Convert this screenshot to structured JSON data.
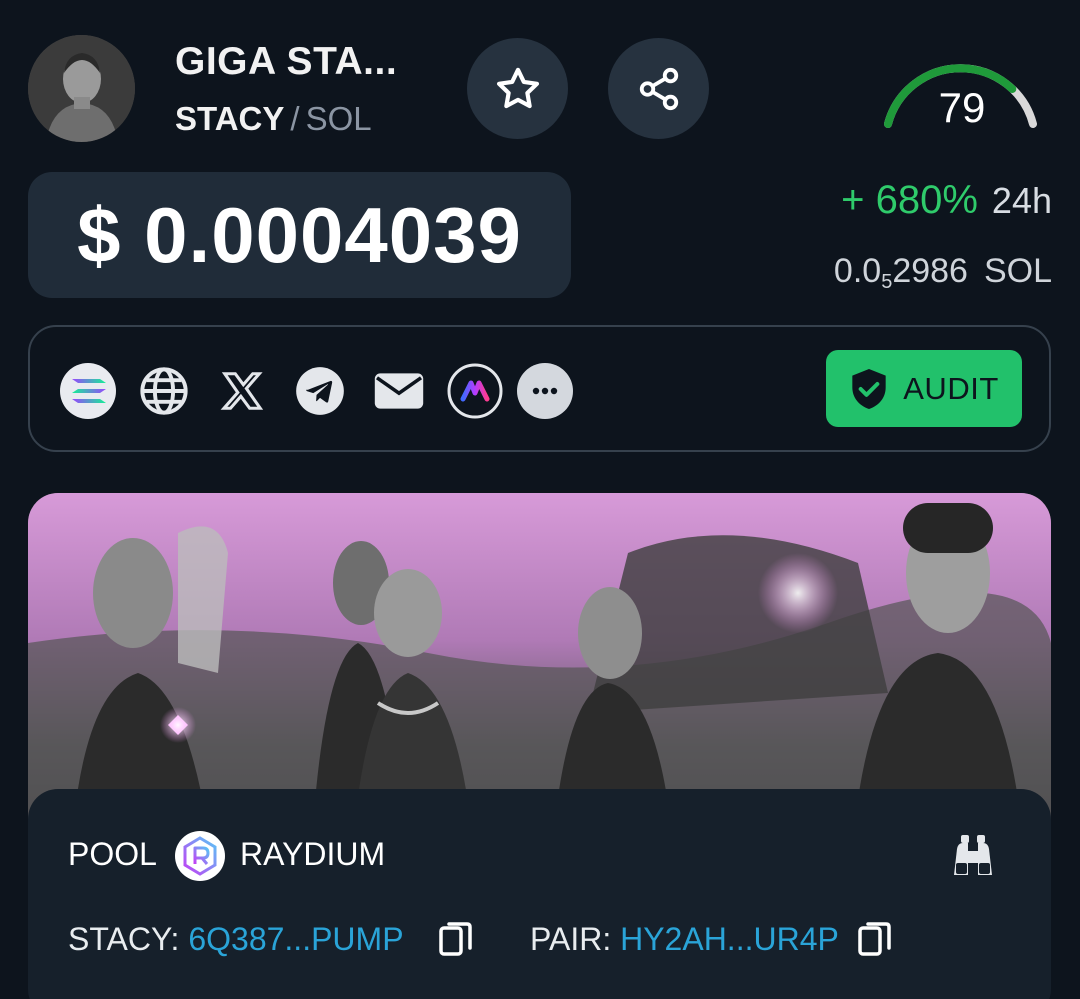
{
  "token": {
    "name": "GIGA STA...",
    "symbol": "STACY",
    "separator": "/",
    "chain": "SOL"
  },
  "score": {
    "value": "79",
    "fraction": 0.79
  },
  "price": {
    "usd": "$ 0.0004039",
    "change": "+ 680%",
    "period": "24h",
    "sol_prefix": "0.0",
    "sol_zeros_sub": "5",
    "sol_digits": "2986",
    "sol_unit": "SOL"
  },
  "icons": {
    "favorite": "star-icon",
    "share": "share-icon",
    "socials": [
      "solana-icon",
      "globe-icon",
      "x-icon",
      "telegram-icon",
      "mail-icon",
      "app-logo-icon",
      "more-icon"
    ],
    "pool_dex": "raydium-icon",
    "explore": "binoculars-icon",
    "copy": "copy-icon"
  },
  "audit": {
    "label": "AUDIT"
  },
  "pool": {
    "label": "POOL",
    "dex": "RAYDIUM",
    "token_key": "STACY:",
    "token_address": "6Q387...PUMP",
    "pair_key": "PAIR:",
    "pair_address": "HY2AH...UR4P"
  },
  "colors": {
    "background": "#0d141d",
    "positive": "#2fcb6b",
    "audit": "#22c16b",
    "link": "#2aa4d8",
    "gauge_active": "#1f9a3a",
    "gauge_rest": "#d9d9d9"
  }
}
